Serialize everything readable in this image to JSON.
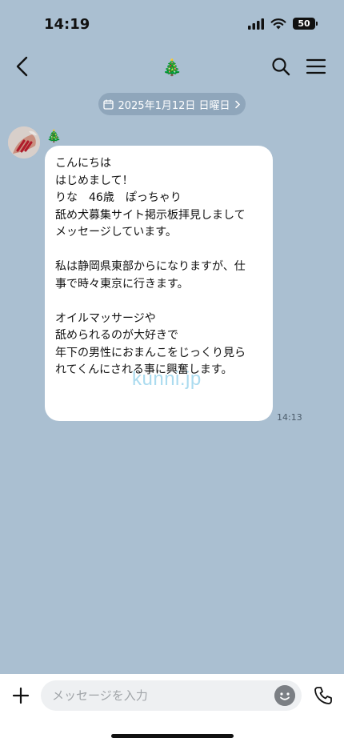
{
  "status": {
    "time": "14:19",
    "battery": "50"
  },
  "chat": {
    "title": "🎄"
  },
  "date_chip": {
    "label": "2025年1月12日 日曜日"
  },
  "message": {
    "sender": "🎄",
    "lines": [
      "こんにちは",
      "はじめまして！",
      "りな　46歳　ぽっちゃり",
      "舐め犬募集サイト掲示板拝見しまして",
      "メッセージしています。",
      "",
      "私は静岡県東部からになりますが、仕",
      "事で時々東京に行きます。",
      "",
      "オイルマッサージや",
      "舐められるのが大好きで",
      "年下の男性におまんこをじっくり見ら",
      "れてくんにされる事に興奮します。"
    ],
    "time": "14:13",
    "watermark": "kunni.jp"
  },
  "composer": {
    "placeholder": "メッセージを入力"
  },
  "icons": {
    "back": "chevron-left-icon",
    "search": "search-icon",
    "menu": "menu-icon",
    "calendar": "calendar-icon",
    "plus": "plus-icon",
    "emoji": "emoji-icon",
    "phone": "phone-icon"
  }
}
